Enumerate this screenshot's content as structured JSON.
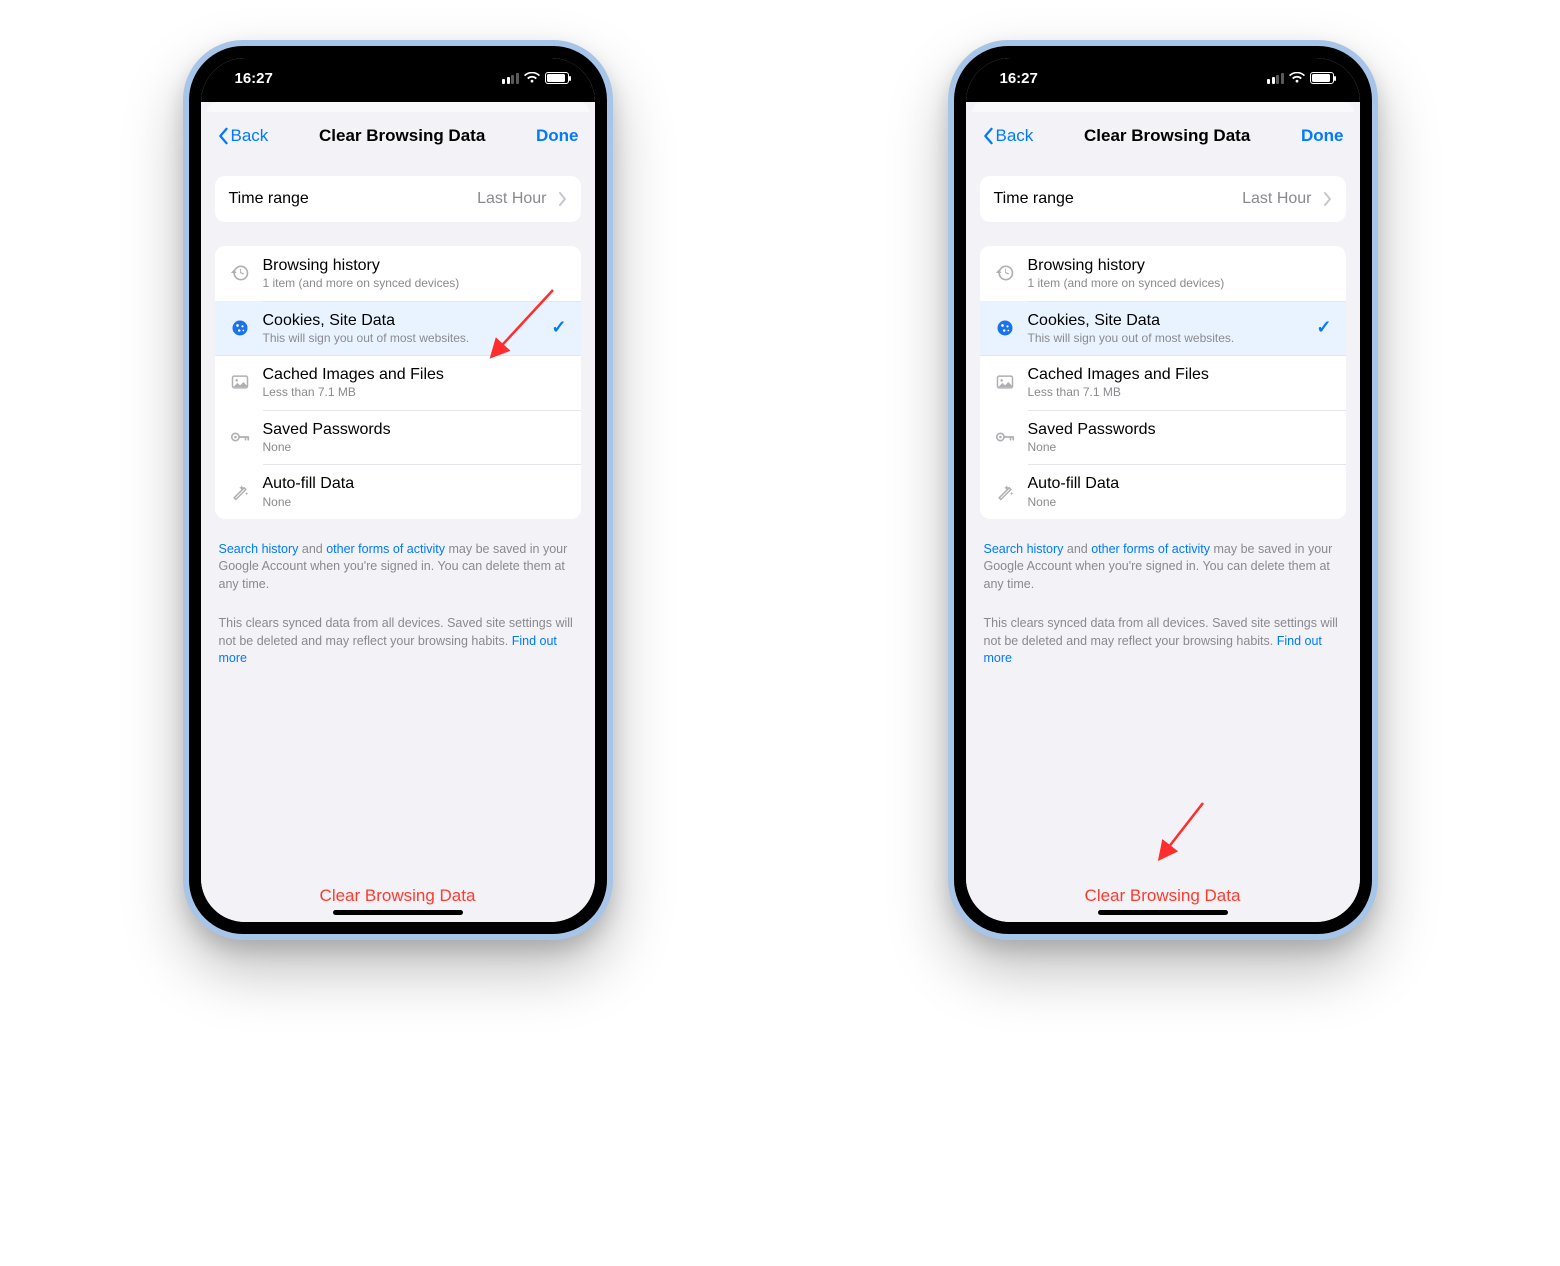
{
  "status": {
    "time": "16:27"
  },
  "nav": {
    "back": "Back",
    "title": "Clear Browsing Data",
    "done": "Done"
  },
  "time_range": {
    "label": "Time range",
    "value": "Last Hour"
  },
  "items": {
    "history": {
      "title": "Browsing history",
      "sub": "1 item (and more on synced devices)"
    },
    "cookies": {
      "title": "Cookies, Site Data",
      "sub": "This will sign you out of most websites."
    },
    "cache": {
      "title": "Cached Images and Files",
      "sub": "Less than 7.1 MB"
    },
    "passwords": {
      "title": "Saved Passwords",
      "sub": "None"
    },
    "autofill": {
      "title": "Auto-fill Data",
      "sub": "None"
    }
  },
  "footer": {
    "link1": "Search history",
    "mid1": " and ",
    "link2": "other forms of activity",
    "rest1": " may be saved in your Google Account when you're signed in. You can delete them at any time.",
    "para2a": "This clears synced data from all devices. Saved site settings will not be deleted and may reflect your browsing habits. ",
    "link3": "Find out more"
  },
  "clear_button": "Clear Browsing Data"
}
